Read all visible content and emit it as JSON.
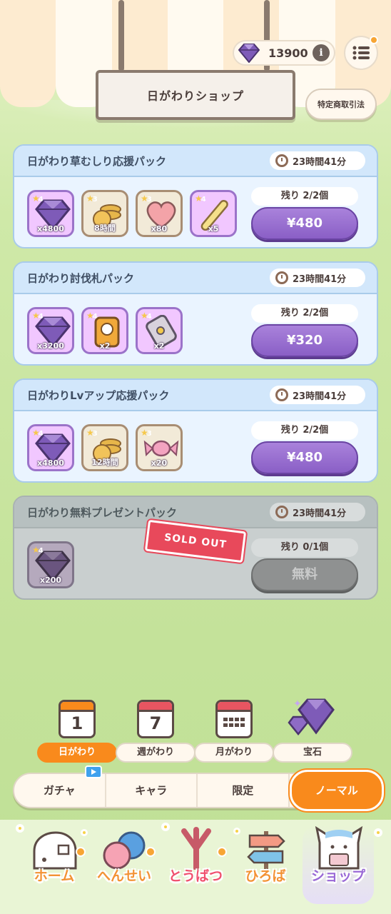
{
  "currency": {
    "gems": "13900",
    "info": "i"
  },
  "header": {
    "title": "日がわりショップ",
    "legal_button": "特定商取引法"
  },
  "packs": [
    {
      "title": "日がわり草むしり応援パック",
      "timer": "23時間41分",
      "stock": "残り 2/2個",
      "price": "¥480",
      "items": [
        {
          "icon": "gem-icon",
          "rank": "4",
          "qty": "x4800"
        },
        {
          "icon": "coins-icon",
          "rank": "3",
          "qty": "8時間"
        },
        {
          "icon": "heart-icon",
          "rank": "3",
          "qty": "x80"
        },
        {
          "icon": "stick-icon",
          "rank": "4",
          "qty": "x5"
        }
      ]
    },
    {
      "title": "日がわり討伐札パック",
      "timer": "23時間41分",
      "stock": "残り 2/2個",
      "price": "¥320",
      "items": [
        {
          "icon": "gem-icon",
          "rank": "4",
          "qty": "x3200"
        },
        {
          "icon": "ticket-icon",
          "rank": "4",
          "qty": "x2"
        },
        {
          "icon": "tag-icon",
          "rank": "4",
          "qty": "x2"
        }
      ]
    },
    {
      "title": "日がわりLvアップ応援パック",
      "timer": "23時間41分",
      "stock": "残り 2/2個",
      "price": "¥480",
      "items": [
        {
          "icon": "gem-icon",
          "rank": "4",
          "qty": "x4800"
        },
        {
          "icon": "coins-icon",
          "rank": "3",
          "qty": "12時間"
        },
        {
          "icon": "candy-icon",
          "rank": "3",
          "qty": "x20"
        }
      ]
    },
    {
      "title": "日がわり無料プレゼントパック",
      "timer": "23時間41分",
      "stock": "残り 0/1個",
      "price": "無料",
      "sold_out": "SOLD OUT",
      "items": [
        {
          "icon": "gem-icon",
          "rank": "4",
          "qty": "x200"
        }
      ]
    }
  ],
  "categories": [
    {
      "label": "日がわり",
      "icon_num": "1",
      "active": true
    },
    {
      "label": "週がわり",
      "icon_num": "7",
      "active": false
    },
    {
      "label": "月がわり",
      "icon_num": "",
      "active": false
    },
    {
      "label": "宝石",
      "icon_num": "",
      "active": false
    }
  ],
  "subtabs": [
    "ガチャ",
    "キャラ",
    "限定",
    "ノーマル"
  ],
  "bottom_nav": [
    {
      "label": "ホーム",
      "color": "#f39234"
    },
    {
      "label": "へんせい",
      "color": "#f39234"
    },
    {
      "label": "とうばつ",
      "color": "#f0506e"
    },
    {
      "label": "ひろば",
      "color": "#f39234"
    },
    {
      "label": "ショップ",
      "color": "#9a69d6"
    }
  ],
  "colors": {
    "accent": "#f98a1c",
    "purple": "#8a5fc6",
    "pack_bg": "#eaf4ff"
  }
}
